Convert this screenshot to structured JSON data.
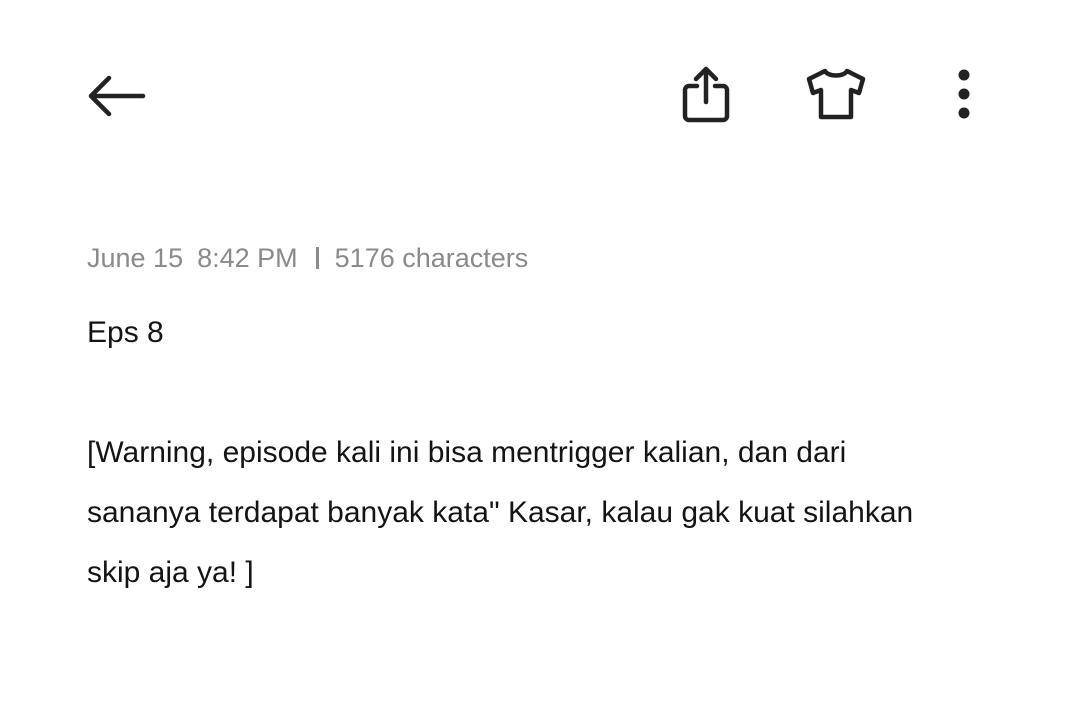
{
  "toolbar": {
    "back_icon": "arrow-left-icon",
    "share_icon": "share-icon",
    "theme_icon": "tshirt-icon",
    "more_icon": "more-vertical-icon"
  },
  "meta": {
    "date": "June 15",
    "time": "8:42 PM",
    "char_count": "5176 characters"
  },
  "note": {
    "title_line": "Eps 8",
    "body_line_1": "[Warning, episode kali ini bisa mentrigger kalian, dan dari",
    "body_line_2": "sananya terdapat banyak kata\" Kasar, kalau gak kuat silahkan",
    "body_line_3": "skip aja ya! ]"
  },
  "colors": {
    "text": "#141414",
    "meta_text": "#8a8a8a",
    "icon": "#222222",
    "background": "#ffffff"
  }
}
